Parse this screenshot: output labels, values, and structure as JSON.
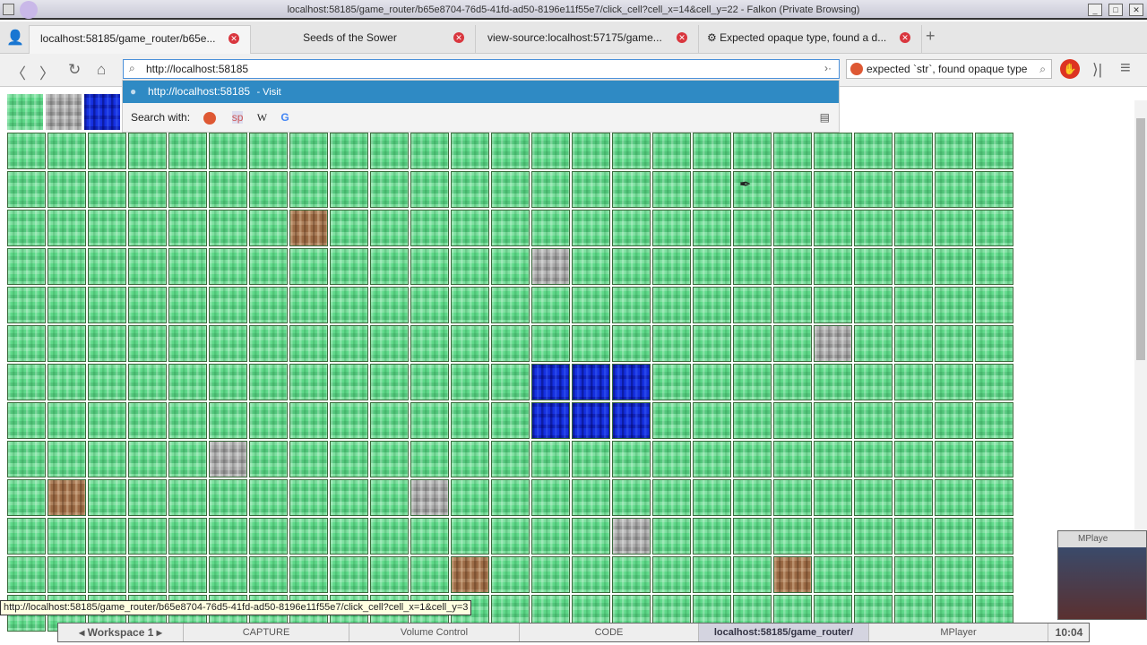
{
  "window": {
    "title": "localhost:58185/game_router/b65e8704-76d5-41fd-ad50-8196e11f55e7/click_cell?cell_x=14&cell_y=22 - Falkon (Private Browsing)"
  },
  "tabs": [
    {
      "label": "localhost:58185/game_router/b65e..."
    },
    {
      "label": "Seeds of the Sower"
    },
    {
      "label": "view-source:localhost:57175/game..."
    },
    {
      "label": "Expected opaque type, found a d..."
    }
  ],
  "navbar": {
    "url": "http://localhost:58185",
    "search": "expected `str`, found opaque type"
  },
  "dropdown": {
    "suggestion": "http://localhost:58185",
    "visit": "- Visit",
    "search_with": "Search with:",
    "engines": [
      "duckduckgo",
      "sp",
      "W",
      "G"
    ]
  },
  "palette": [
    "grass",
    "stone",
    "water"
  ],
  "grid": {
    "columns": 25,
    "visible_rows": 13,
    "default": "grass",
    "special": [
      {
        "x": 7,
        "y": 2,
        "type": "dirt"
      },
      {
        "x": 13,
        "y": 3,
        "type": "stone"
      },
      {
        "x": 20,
        "y": 5,
        "type": "stone"
      },
      {
        "x": 13,
        "y": 6,
        "type": "water"
      },
      {
        "x": 14,
        "y": 6,
        "type": "water"
      },
      {
        "x": 15,
        "y": 6,
        "type": "water"
      },
      {
        "x": 13,
        "y": 7,
        "type": "water"
      },
      {
        "x": 14,
        "y": 7,
        "type": "water"
      },
      {
        "x": 15,
        "y": 7,
        "type": "water"
      },
      {
        "x": 5,
        "y": 8,
        "type": "stone"
      },
      {
        "x": 1,
        "y": 9,
        "type": "dirt"
      },
      {
        "x": 10,
        "y": 9,
        "type": "stone"
      },
      {
        "x": 15,
        "y": 10,
        "type": "stone"
      },
      {
        "x": 11,
        "y": 11,
        "type": "dirt"
      },
      {
        "x": 19,
        "y": 11,
        "type": "dirt"
      }
    ]
  },
  "status": "http://localhost:58185/game_router/b65e8704-76d5-41fd-ad50-8196e11f55e7/click_cell?cell_x=1&cell_y=3",
  "taskbar": {
    "workspace": "Workspace 1",
    "items": [
      "CAPTURE",
      "Volume Control",
      "CODE",
      "localhost:58185/game_router/",
      "MPlayer"
    ],
    "clock": "10:04"
  },
  "mplayer": {
    "title": "MPlaye"
  }
}
